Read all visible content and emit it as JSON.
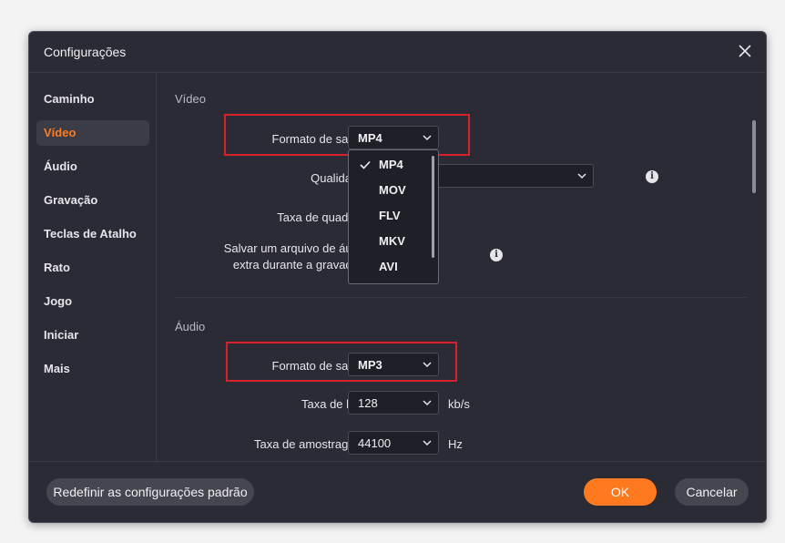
{
  "dialog": {
    "title": "Configurações"
  },
  "sidebar": {
    "items": [
      {
        "label": "Caminho"
      },
      {
        "label": "Vídeo",
        "active": true
      },
      {
        "label": "Áudio"
      },
      {
        "label": "Gravação"
      },
      {
        "label": "Teclas de Atalho"
      },
      {
        "label": "Rato"
      },
      {
        "label": "Jogo"
      },
      {
        "label": "Iniciar"
      },
      {
        "label": "Mais"
      }
    ]
  },
  "video": {
    "section_title": "Vídeo",
    "format_label": "Formato de saída:",
    "format_value": "MP4",
    "quality_label": "Qualidade:",
    "framerate_label": "Taxa de quadros:",
    "extra_audio_label_line1": "Salvar um arquivo de áudio",
    "extra_audio_label_line2": "extra durante a gravação:",
    "format_options": [
      "MP4",
      "MOV",
      "FLV",
      "MKV",
      "AVI"
    ],
    "selected_option": "MP4"
  },
  "audio": {
    "section_title": "Áudio",
    "format_label": "Formato de saída:",
    "format_value": "MP3",
    "bitrate_label": "Taxa de bits:",
    "bitrate_value": "128",
    "bitrate_unit": "kb/s",
    "samplerate_label": "Taxa de amostragem:",
    "samplerate_value": "44100",
    "samplerate_unit": "Hz"
  },
  "footer": {
    "reset_label": "Redefinir as configurações padrão",
    "ok_label": "OK",
    "cancel_label": "Cancelar"
  },
  "colors": {
    "accent": "#ff7a1f",
    "highlight": "#d8202a",
    "background": "#2a2b34"
  },
  "icons": {
    "close": "close-icon",
    "chevron": "chevron-down-icon",
    "info": "info-icon",
    "check": "check-icon"
  }
}
